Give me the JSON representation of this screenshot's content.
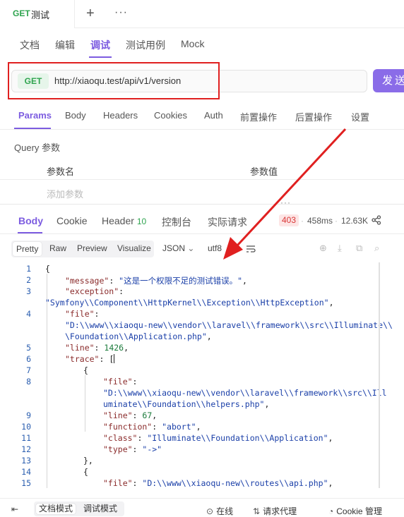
{
  "request_tab": {
    "method": "GET",
    "name": "测试"
  },
  "sub_tabs": [
    "文档",
    "编辑",
    "调试",
    "测试用例",
    "Mock"
  ],
  "active_sub_tab": "调试",
  "url_bar": {
    "method": "GET",
    "url": "http://xiaoqu.test/api/v1/version",
    "send_label": "发送"
  },
  "param_tabs": [
    "Params",
    "Body",
    "Headers",
    "Cookies",
    "Auth",
    "前置操作",
    "后置操作",
    "设置"
  ],
  "active_param_tab": "Params",
  "query": {
    "label": "Query 参数",
    "col_name": "参数名",
    "col_value": "参数值",
    "add_placeholder": "添加参数"
  },
  "response_tabs": {
    "body": "Body",
    "cookie": "Cookie",
    "header": "Header",
    "header_count": "10",
    "console": "控制台",
    "actual": "实际请求"
  },
  "response_meta": {
    "status": "403",
    "time": "458ms",
    "size": "12.63K"
  },
  "view_modes": [
    "Pretty",
    "Raw",
    "Preview",
    "Visualize"
  ],
  "active_view_mode": "Pretty",
  "format": "JSON",
  "encoding": "utf8",
  "colors": {
    "accent": "#7c5ce0",
    "get": "#2fa44f",
    "error": "#d93636",
    "annotation": "#e02020"
  },
  "code_lines": [
    {
      "n": "1",
      "parts": [
        [
          "p",
          "{"
        ]
      ]
    },
    {
      "n": "2",
      "parts": [
        [
          "k",
          "\"message\""
        ],
        [
          "p",
          ": "
        ],
        [
          "s",
          "\"这是一个权限不足的测试错误。\""
        ],
        [
          "p",
          ","
        ]
      ]
    },
    {
      "n": "3",
      "parts": [
        [
          "k",
          "\"exception\""
        ],
        [
          "p",
          ":"
        ]
      ]
    },
    {
      "n": "",
      "parts": [
        [
          "s",
          "\"Symfony\\\\Component\\\\HttpKernel\\\\Exception\\\\HttpException\""
        ],
        [
          "p",
          ","
        ]
      ]
    },
    {
      "n": "4",
      "parts": [
        [
          "k",
          "\"file\""
        ],
        [
          "p",
          ":"
        ]
      ]
    },
    {
      "n": "",
      "parts": [
        [
          "s",
          "\"D:\\\\www\\\\xiaoqu-new\\\\vendor\\\\laravel\\\\framework\\\\src\\\\Illuminate\\\\"
        ]
      ]
    },
    {
      "n": "",
      "parts": [
        [
          "s",
          "\\Foundation\\\\Application.php\""
        ],
        [
          "p",
          ","
        ]
      ]
    },
    {
      "n": "5",
      "parts": [
        [
          "k",
          "\"line\""
        ],
        [
          "p",
          ": "
        ],
        [
          "n",
          "1426"
        ],
        [
          "p",
          ","
        ]
      ]
    },
    {
      "n": "6",
      "parts": [
        [
          "k",
          "\"trace\""
        ],
        [
          "p",
          ": ["
        ]
      ]
    },
    {
      "n": "7",
      "parts": [
        [
          "p",
          "{"
        ]
      ]
    },
    {
      "n": "8",
      "parts": [
        [
          "k",
          "\"file\""
        ],
        [
          "p",
          ":"
        ]
      ]
    },
    {
      "n": "",
      "parts": [
        [
          "s",
          "\"D:\\\\www\\\\xiaoqu-new\\\\vendor\\\\laravel\\\\framework\\\\src\\\\Ill"
        ]
      ]
    },
    {
      "n": "",
      "parts": [
        [
          "s",
          "uminate\\\\Foundation\\\\helpers.php\""
        ],
        [
          "p",
          ","
        ]
      ]
    },
    {
      "n": "9",
      "parts": [
        [
          "k",
          "\"line\""
        ],
        [
          "p",
          ": "
        ],
        [
          "n",
          "67"
        ],
        [
          "p",
          ","
        ]
      ]
    },
    {
      "n": "10",
      "parts": [
        [
          "k",
          "\"function\""
        ],
        [
          "p",
          ": "
        ],
        [
          "s",
          "\"abort\""
        ],
        [
          "p",
          ","
        ]
      ]
    },
    {
      "n": "11",
      "parts": [
        [
          "k",
          "\"class\""
        ],
        [
          "p",
          ": "
        ],
        [
          "s",
          "\"Illuminate\\\\Foundation\\\\Application\""
        ],
        [
          "p",
          ","
        ]
      ]
    },
    {
      "n": "12",
      "parts": [
        [
          "k",
          "\"type\""
        ],
        [
          "p",
          ": "
        ],
        [
          "s",
          "\"->\""
        ]
      ]
    },
    {
      "n": "13",
      "parts": [
        [
          "p",
          "},"
        ]
      ]
    },
    {
      "n": "14",
      "parts": [
        [
          "p",
          "{"
        ]
      ]
    },
    {
      "n": "15",
      "parts": [
        [
          "k",
          "\"file\""
        ],
        [
          "p",
          ": "
        ],
        [
          "s",
          "\"D:\\\\www\\\\xiaoqu-new\\\\routes\\\\api.php\""
        ],
        [
          "p",
          ","
        ]
      ]
    }
  ],
  "bottom_bar": {
    "doc_mode": "文档模式",
    "debug_mode": "调试模式",
    "online": "在线",
    "proxy": "请求代理",
    "cookie": "Cookie 管理"
  }
}
